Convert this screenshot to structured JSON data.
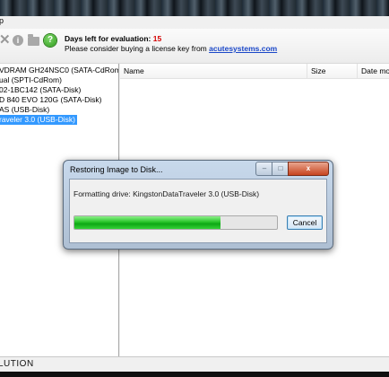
{
  "menu": {
    "partial_label": "lp"
  },
  "toolbar": {
    "eval_label": "Days left for evaluation:",
    "days_left": "15",
    "license_text": "Please consider buying a license key from",
    "license_link": "acutesystems.com"
  },
  "drives": [
    {
      "label": "VDRAM GH24NSC0 (SATA-CdRom)",
      "selected": false
    },
    {
      "label": "ual (SPTI-CdRom)",
      "selected": false
    },
    {
      "label": "02-1BC142 (SATA-Disk)",
      "selected": false
    },
    {
      "label": "D 840 EVO 120G (SATA-Disk)",
      "selected": false
    },
    {
      "label": "AS (USB-Disk)",
      "selected": false
    },
    {
      "label": "raveler 3.0 (USB-Disk)",
      "selected": true
    }
  ],
  "list": {
    "columns": [
      "Name",
      "Size",
      "Date mod"
    ]
  },
  "status": {
    "text": "LUTION"
  },
  "dialog": {
    "title": "Restoring Image to Disk...",
    "message": "Formatting drive: KingstonDataTraveler 3.0 (USB-Disk)",
    "progress_fraction": 0.72,
    "cancel_label": "Cancel",
    "close_glyph": "x",
    "min_glyph": "–",
    "max_glyph": "□"
  },
  "colors": {
    "days_left": "#d40000",
    "link": "#1a47c8",
    "selection": "#3399ff",
    "progress": "#28c42a"
  },
  "icons": [
    "close-icon",
    "info-icon",
    "folder-icon",
    "help-icon"
  ]
}
